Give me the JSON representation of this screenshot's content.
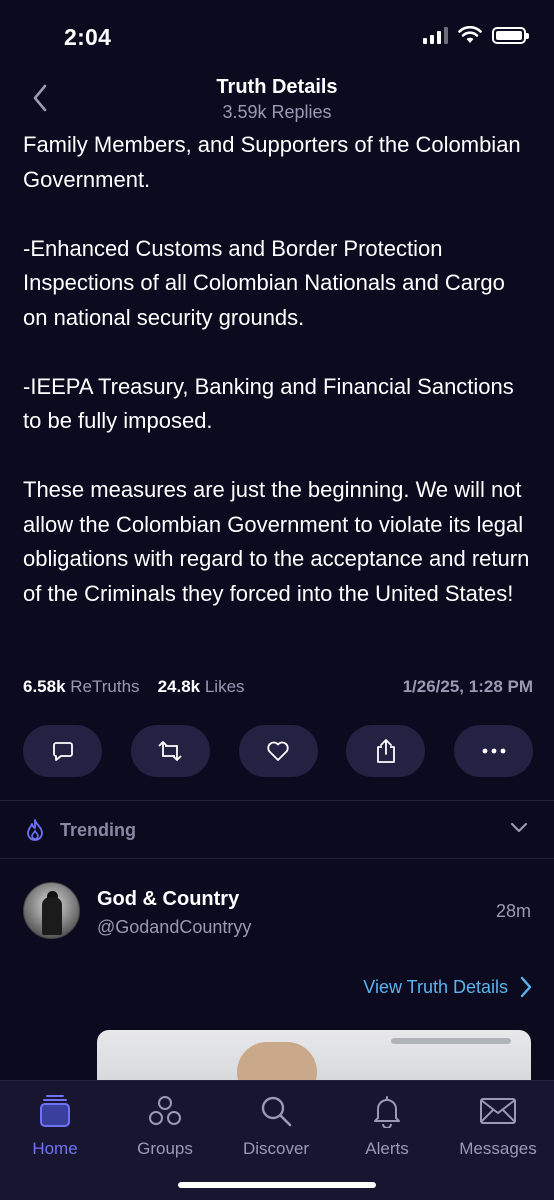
{
  "status_bar": {
    "time": "2:04"
  },
  "header": {
    "title": "Truth Details",
    "subtitle": "3.59k Replies"
  },
  "post": {
    "paragraphs": [
      "Family Members, and Supporters of the Colombian Government.",
      "-Enhanced Customs and Border Protection Inspections of all Colombian Nationals and Cargo on national security grounds.",
      "-IEEPA Treasury, Banking and Financial Sanctions to be fully imposed.",
      "These measures are just the beginning. We will not allow the Colombian Government to violate its legal obligations with regard to the acceptance and return of the Criminals they forced into the United States!"
    ],
    "stats": {
      "retruths_count": "6.58k",
      "retruths_label": "ReTruths",
      "likes_count": "24.8k",
      "likes_label": "Likes",
      "date": "1/26/25, 1:28 PM"
    }
  },
  "actions": [
    "reply-icon",
    "retruth-icon",
    "heart-icon",
    "share-icon",
    "more-icon"
  ],
  "trending": {
    "label": "Trending"
  },
  "reply": {
    "name": "God & Country",
    "handle": "@GodandCountryy",
    "time": "28m",
    "view_details": "View Truth Details"
  },
  "tabs": [
    {
      "label": "Home",
      "icon": "home-icon",
      "active": true
    },
    {
      "label": "Groups",
      "icon": "groups-icon",
      "active": false
    },
    {
      "label": "Discover",
      "icon": "search-icon",
      "active": false
    },
    {
      "label": "Alerts",
      "icon": "bell-icon",
      "active": false
    },
    {
      "label": "Messages",
      "icon": "mail-icon",
      "active": false
    }
  ],
  "colors": {
    "background": "#0c0a1f",
    "accent": "#6e74f5",
    "link": "#5ab4f0",
    "muted": "#9b98b3",
    "button_bg": "#242243"
  }
}
